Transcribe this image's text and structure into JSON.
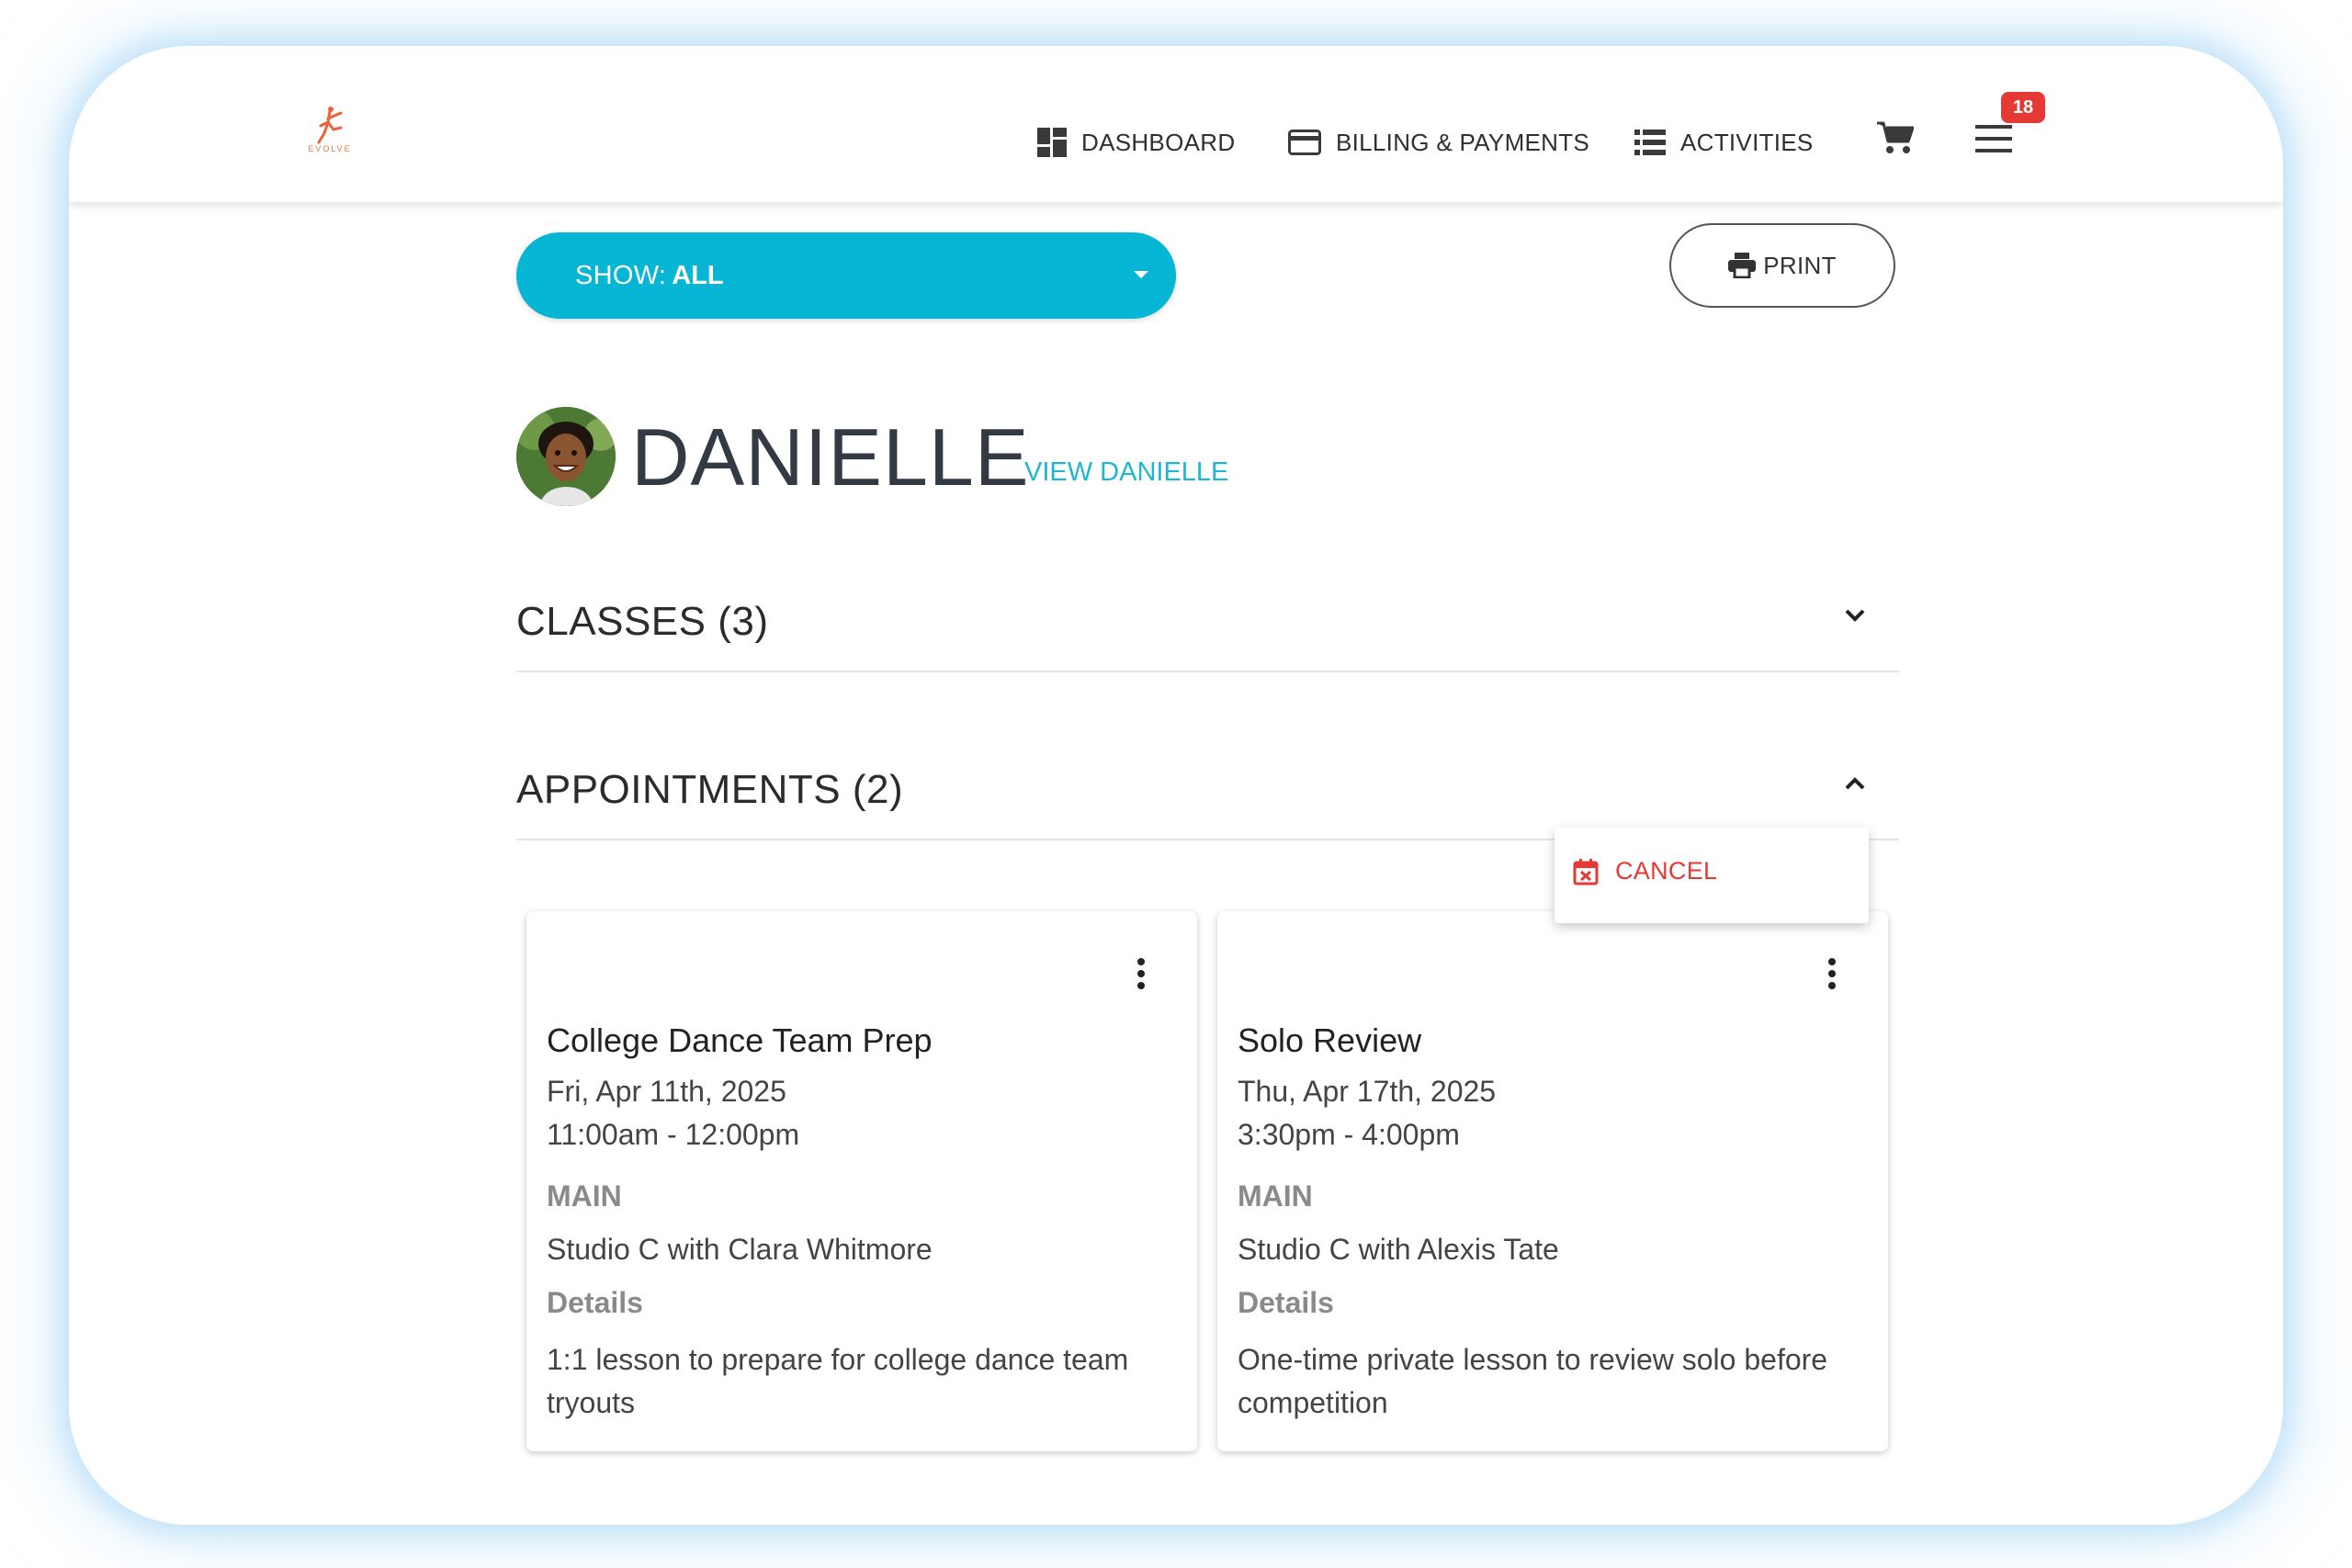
{
  "header": {
    "logo_text": "EVOLVE",
    "nav": {
      "dashboard": "DASHBOARD",
      "billing": "BILLING & PAYMENTS",
      "activities": "ACTIVITIES"
    },
    "notification_count": "18",
    "icons": [
      "dashboard-icon",
      "credit-card-icon",
      "list-icon",
      "cart-icon",
      "hamburger-menu-icon"
    ]
  },
  "filter": {
    "label": "SHOW:",
    "value": "ALL"
  },
  "print_label": "PRINT",
  "student": {
    "name": "DANIELLE",
    "view_link": "VIEW DANIELLE"
  },
  "sections": {
    "classes": "CLASSES (3)",
    "appointments": "APPOINTMENTS (2)"
  },
  "context_menu": {
    "cancel_label": "CANCEL"
  },
  "appointments": [
    {
      "title": "College Dance Team Prep",
      "date": "Fri, Apr 11th, 2025",
      "time": "11:00am - 12:00pm",
      "location_heading": "MAIN",
      "location": "Studio C with Clara Whitmore",
      "details_heading": "Details",
      "details": "1:1 lesson to prepare for college dance team tryouts"
    },
    {
      "title": "Solo Review",
      "date": "Thu, Apr 17th, 2025",
      "time": "3:30pm - 4:00pm",
      "location_heading": "MAIN",
      "location": "Studio C with Alexis Tate",
      "details_heading": "Details",
      "details": "One-time private lesson to review solo before competition"
    }
  ],
  "colors": {
    "accent": "#06b6d4",
    "link": "#1eb7cf",
    "danger": "#e53935"
  }
}
